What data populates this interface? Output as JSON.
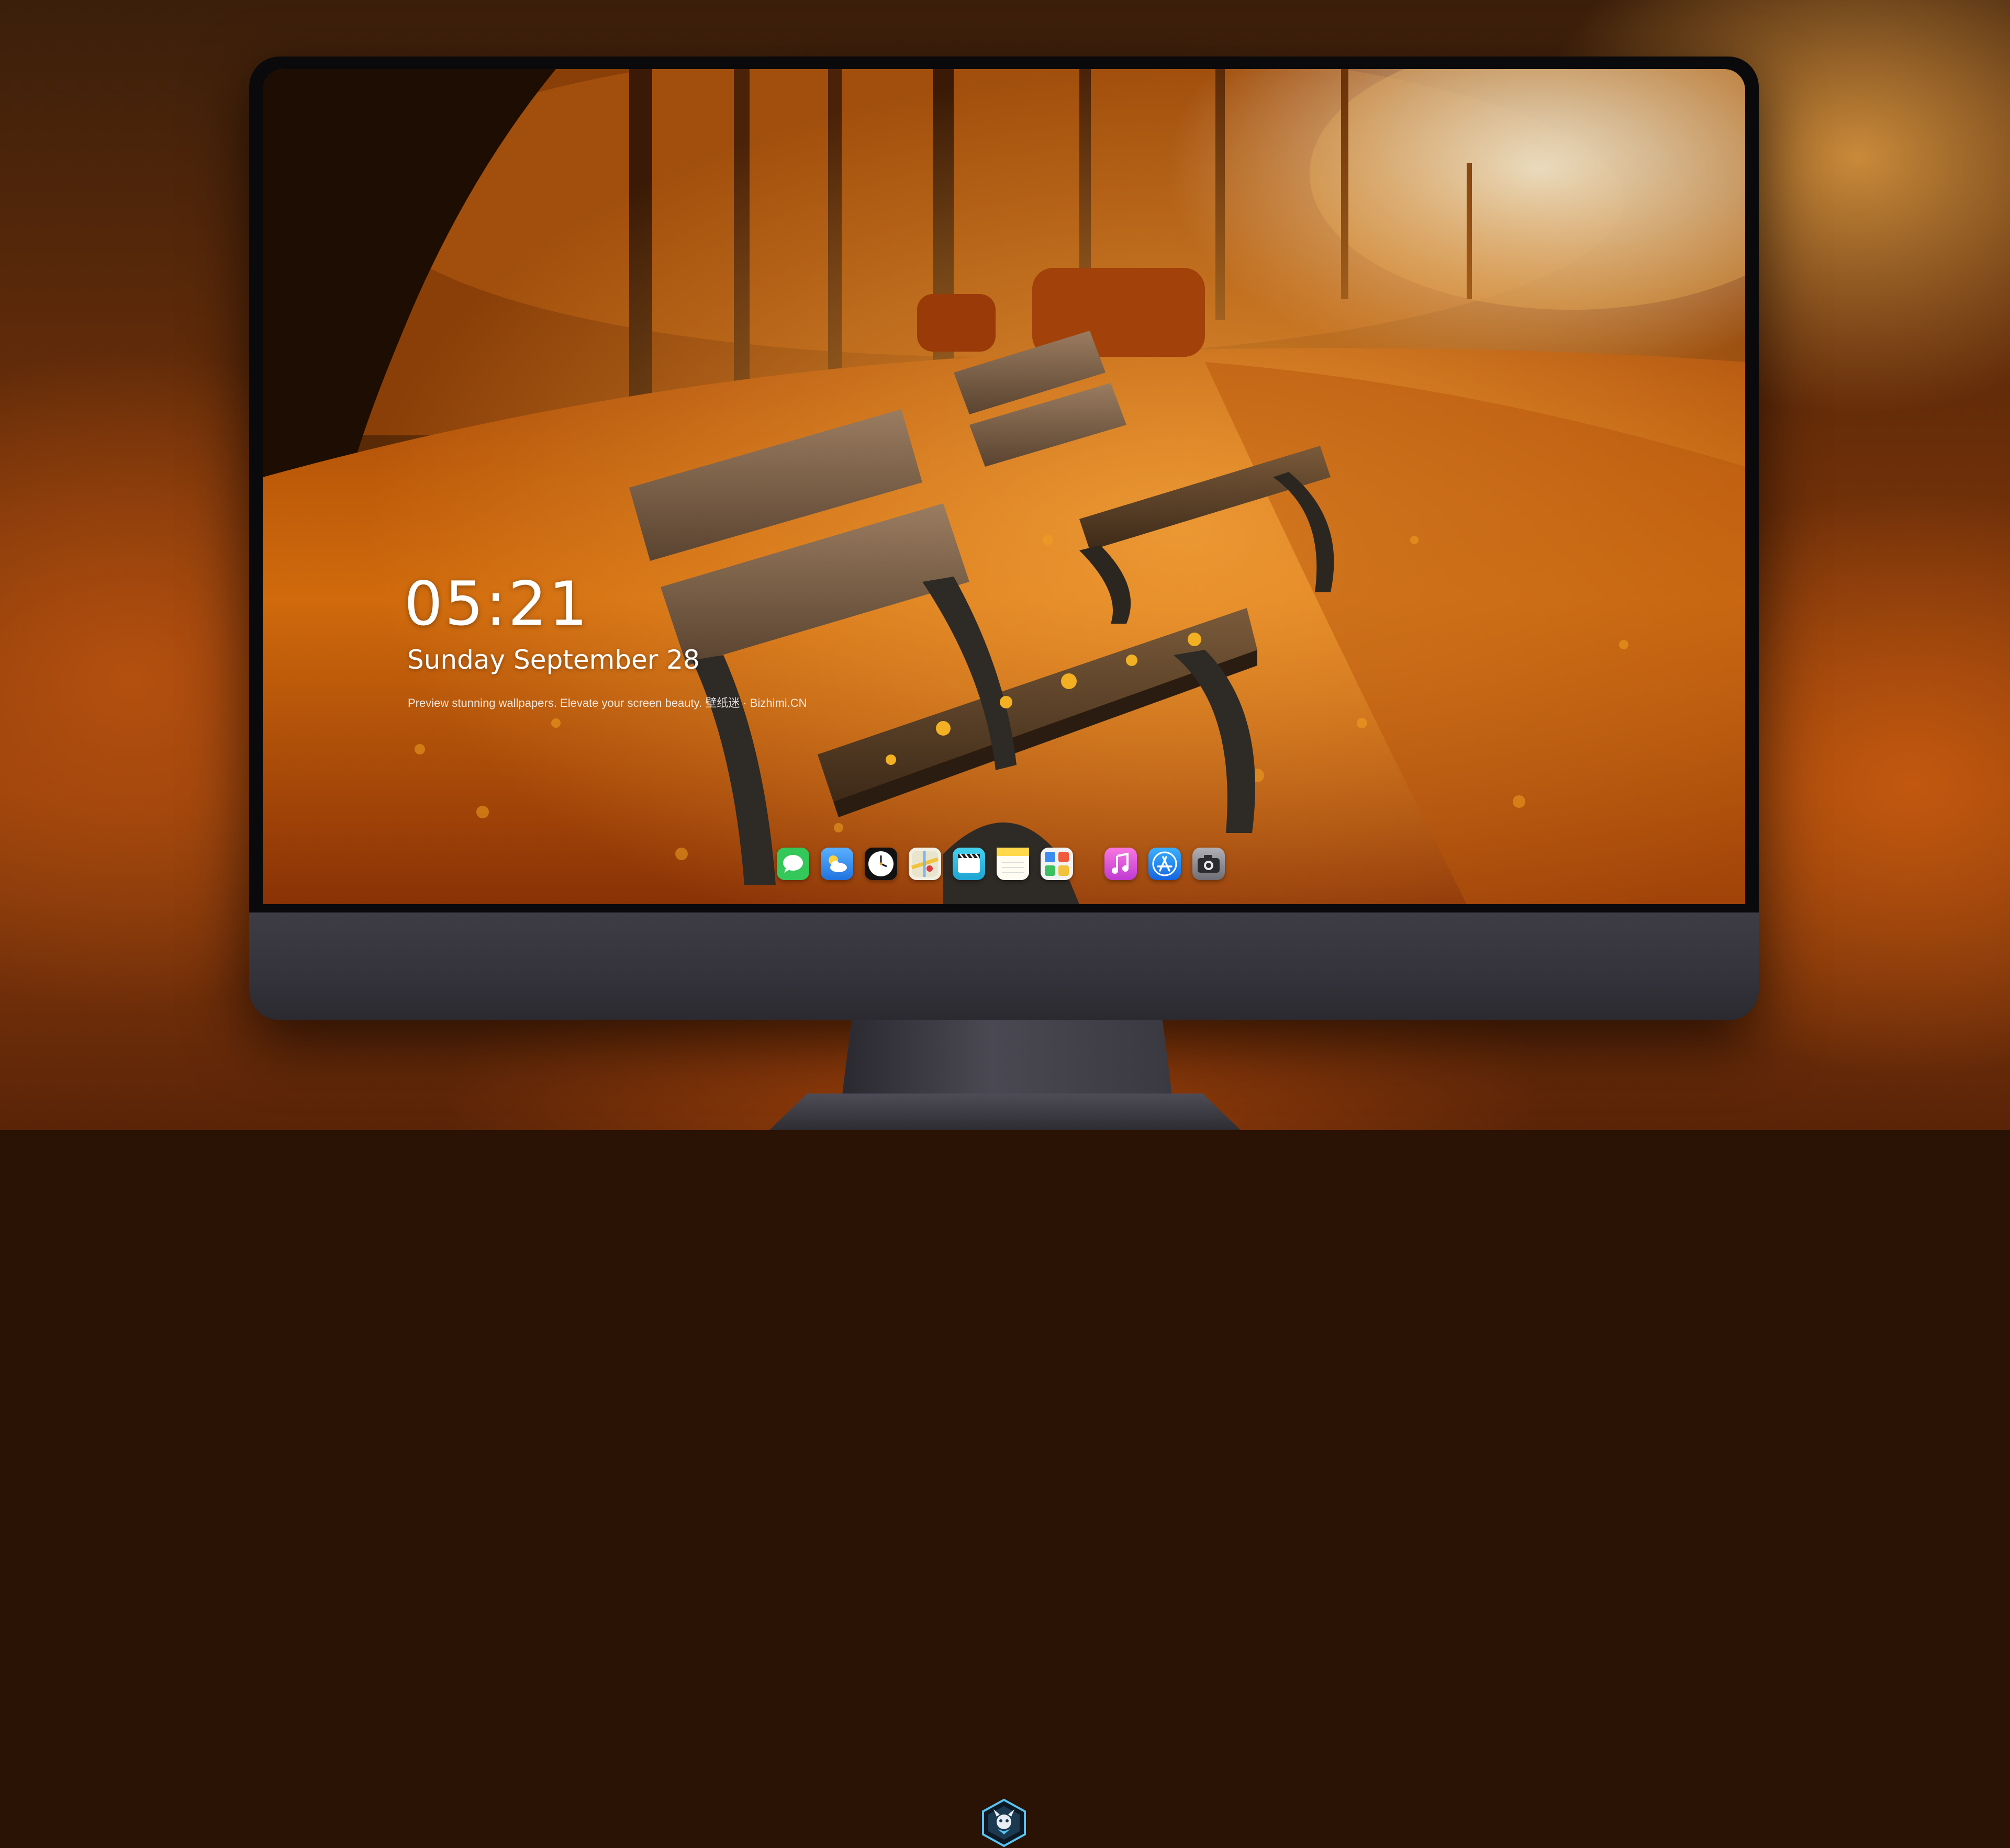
{
  "lockscreen": {
    "time": "05:21",
    "date": "Sunday September  28",
    "tagline": "Preview stunning wallpapers. Elevate your screen beauty. 壁纸迷 · Bizhimi.CN"
  },
  "dock": {
    "apps": [
      {
        "name": "messages-icon",
        "color": "#34c759"
      },
      {
        "name": "weather-icon",
        "color": "#2f8ef5"
      },
      {
        "name": "clock-icon",
        "color": "#ffffff"
      },
      {
        "name": "maps-icon",
        "color": "#f1d36a"
      },
      {
        "name": "clips-icon",
        "color": "#2cc6e8"
      },
      {
        "name": "notes-icon",
        "color": "#ffd94a"
      },
      {
        "name": "photos-grid-icon",
        "color": "#f2f2f2"
      },
      {
        "name": "itunes-icon",
        "color": "#f15bd4"
      },
      {
        "name": "app-store-icon",
        "color": "#1e88f5"
      },
      {
        "name": "camera-icon",
        "color": "#8e8e93"
      }
    ]
  },
  "theme": {
    "accent": "#e8781a",
    "bezel": "#0a0a0c",
    "chin": "#3a3840"
  }
}
